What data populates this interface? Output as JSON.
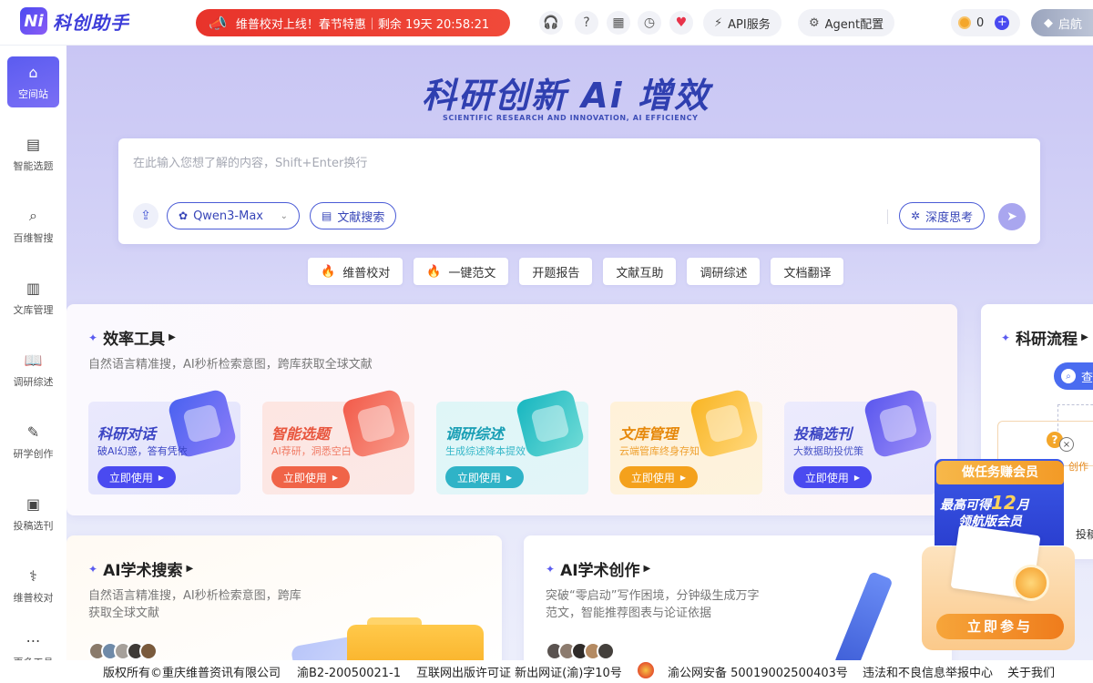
{
  "header": {
    "logo_mark": "Ni",
    "app_title": "科创助手",
    "promo_text": "维普校对上线！春节特惠｜剩余 19天 20:58:21",
    "icons": [
      "headset-icon",
      "help-icon",
      "calendar-icon",
      "history-icon",
      "heart-pulse-icon"
    ],
    "api_label": "API服务",
    "agent_label": "Agent配置",
    "coin_count": "0",
    "vip_label": "启航"
  },
  "sidebar": {
    "items": [
      {
        "label": "空间站",
        "icon": "home-icon",
        "active": true
      },
      {
        "label": "智能选题",
        "icon": "clipboard-icon"
      },
      {
        "label": "百维智搜",
        "icon": "search-stack-icon"
      },
      {
        "label": "文库管理",
        "icon": "library-icon"
      },
      {
        "label": "调研综述",
        "icon": "book-open-icon"
      },
      {
        "label": "研学创作",
        "icon": "edit-icon"
      },
      {
        "label": "投稿选刊",
        "icon": "journal-icon"
      },
      {
        "label": "维普校对",
        "icon": "stethoscope-icon"
      },
      {
        "label": "更多工具",
        "icon": "more-icon"
      }
    ]
  },
  "hero": {
    "title": "科研创新 Ai 增效",
    "subtitle": "SCIENTIFIC RESEARCH AND INNOVATION, AI EFFICIENCY"
  },
  "search": {
    "placeholder": "在此输入您想了解的内容，Shift+Enter换行",
    "value": "",
    "model_label": "Qwen3-Max",
    "literature_label": "文献搜索",
    "deep_think_label": "深度思考"
  },
  "quick_chips": [
    {
      "label": "维普校对",
      "hot": true
    },
    {
      "label": "一键范文",
      "hot": true
    },
    {
      "label": "开题报告",
      "hot": false
    },
    {
      "label": "文献互助",
      "hot": false
    },
    {
      "label": "调研综述",
      "hot": false
    },
    {
      "label": "文档翻译",
      "hot": false
    }
  ],
  "efficiency": {
    "title": "效率工具",
    "desc": "自然语言精准搜，AI秒析检索意图，跨库获取全球文献",
    "cards": [
      {
        "title": "科研对话",
        "desc": "破AI幻惑，答有凭依",
        "button": "立即使用"
      },
      {
        "title": "智能选题",
        "desc": "AI荐研，洞悉空白",
        "button": "立即使用"
      },
      {
        "title": "调研综述",
        "desc": "生成综述降本提效",
        "button": "立即使用"
      },
      {
        "title": "文库管理",
        "desc": "云端管库终身存知",
        "button": "立即使用"
      },
      {
        "title": "投稿选刊",
        "desc": "大数据助投优策",
        "button": "立即使用"
      }
    ]
  },
  "flow": {
    "title": "科研流程",
    "node_label": "查",
    "item_partial_1": "创作",
    "item_partial_2": "投稿"
  },
  "academic_search": {
    "title": "AI学术搜索",
    "desc_line1": "自然语言精准搜，AI秒析检索意图，跨库",
    "desc_line2": "获取全球文献"
  },
  "academic_write": {
    "title": "AI学术创作",
    "desc_line1": "突破“零启动”写作困境，分钟级生成万字",
    "desc_line2": "范文，智能推荐图表与论证依据"
  },
  "member_promo": {
    "badge": "做任务赚会员",
    "line1_prefix": "最高可得",
    "line1_number": "12",
    "line1_suffix": "月",
    "line2": "领航版会员",
    "button": "立即参与"
  },
  "footer": {
    "copyright": "版权所有©重庆维普资讯有限公司",
    "icp": "渝B2-20050021-1",
    "publish_license": "互联网出版许可证 新出网证(渝)字10号",
    "police": "渝公网安备 50019002500403号",
    "report": "违法和不良信息举报中心",
    "about": "关于我们"
  },
  "colors": {
    "brand": "#4a4af0",
    "promo_red": "#e8332b",
    "accent_orange": "#f4a11c"
  }
}
